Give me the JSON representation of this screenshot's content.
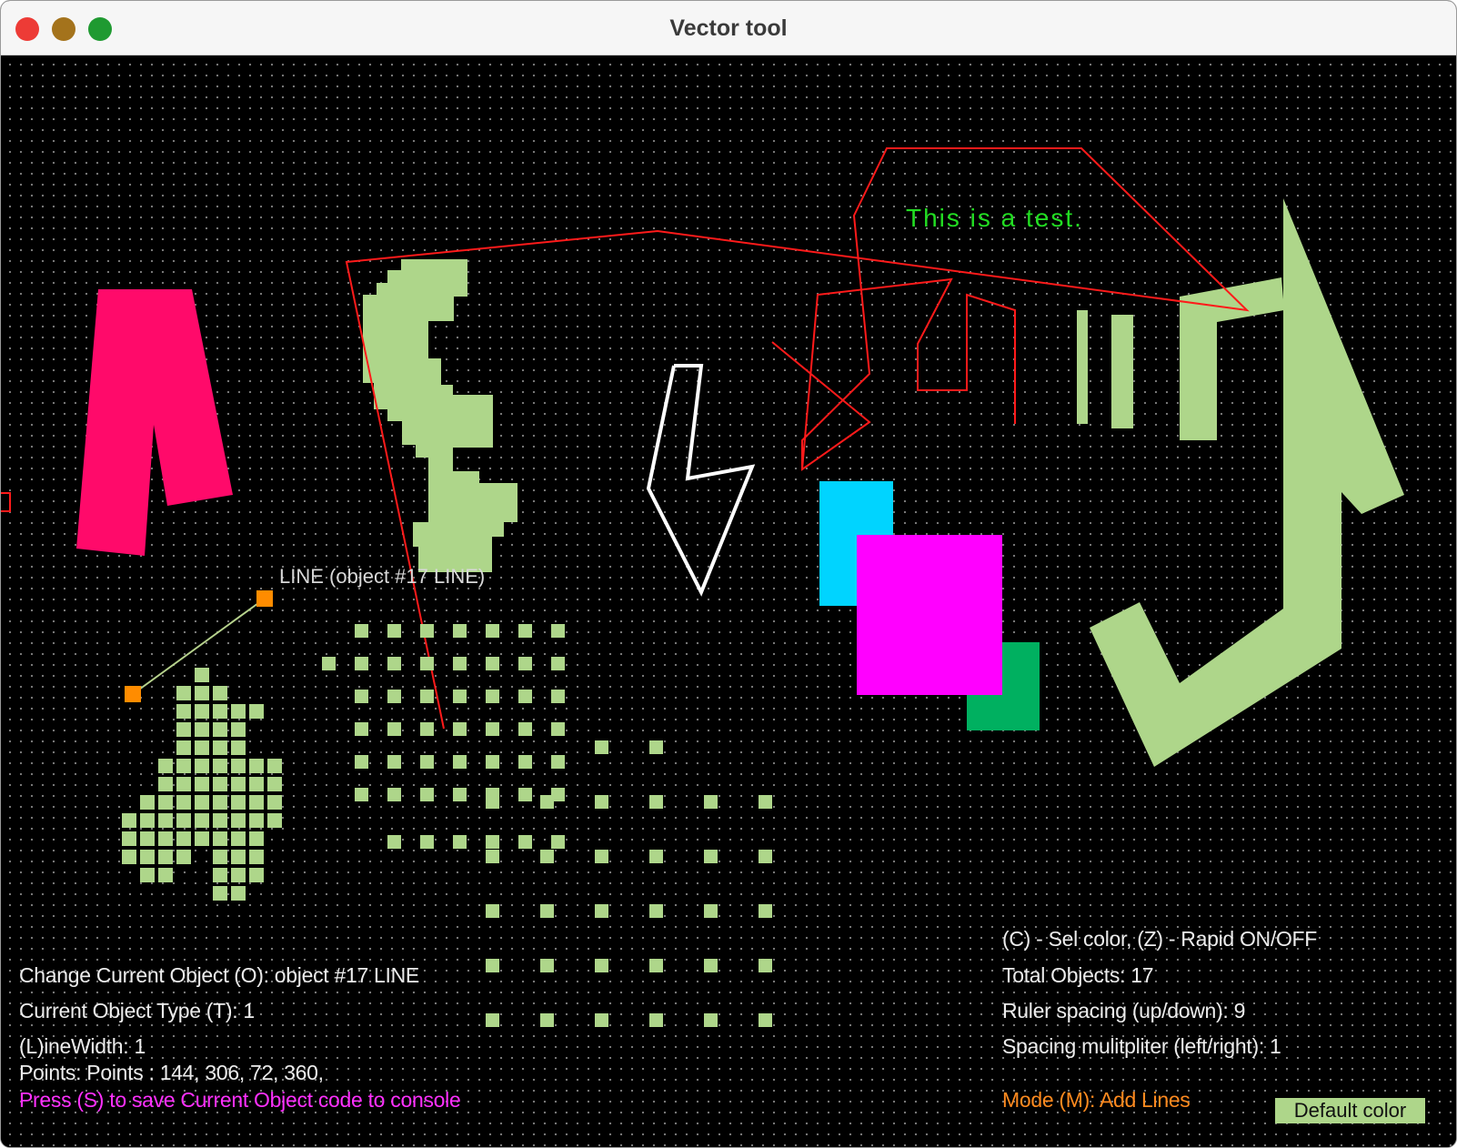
{
  "window": {
    "title": "Vector tool"
  },
  "colors": {
    "background": "#000000",
    "green_shape": "#aed68a",
    "pink": "#ff0a6a",
    "cyan": "#00d4ff",
    "magenta": "#ff00ff",
    "dark_green": "#00b060",
    "red_line": "#ff1a1a",
    "handle": "#ff8c00"
  },
  "canvas": {
    "test_text": "This is a test.",
    "selected_object_label": "LINE (object #17 LINE)"
  },
  "hud_left": {
    "current_object": "Change Current Object (O): object #17 LINE",
    "object_type": "Current Object Type (T): 1",
    "line_width": "(L)ineWidth: 1",
    "points": "Points: Points : 144, 306, 72, 360,",
    "save_hint": "Press (S) to save Current Object code to console"
  },
  "hud_right": {
    "color_rapid": "(C) - Sel color, (Z) - Rapid ON/OFF",
    "total_objects": "Total Objects: 17",
    "ruler_spacing": "Ruler spacing (up/down): 9",
    "spacing_multiplier": "Spacing mulitpliter (left/right): 1",
    "mode": "Mode (M): Add Lines",
    "default_color_button": "Default color"
  }
}
